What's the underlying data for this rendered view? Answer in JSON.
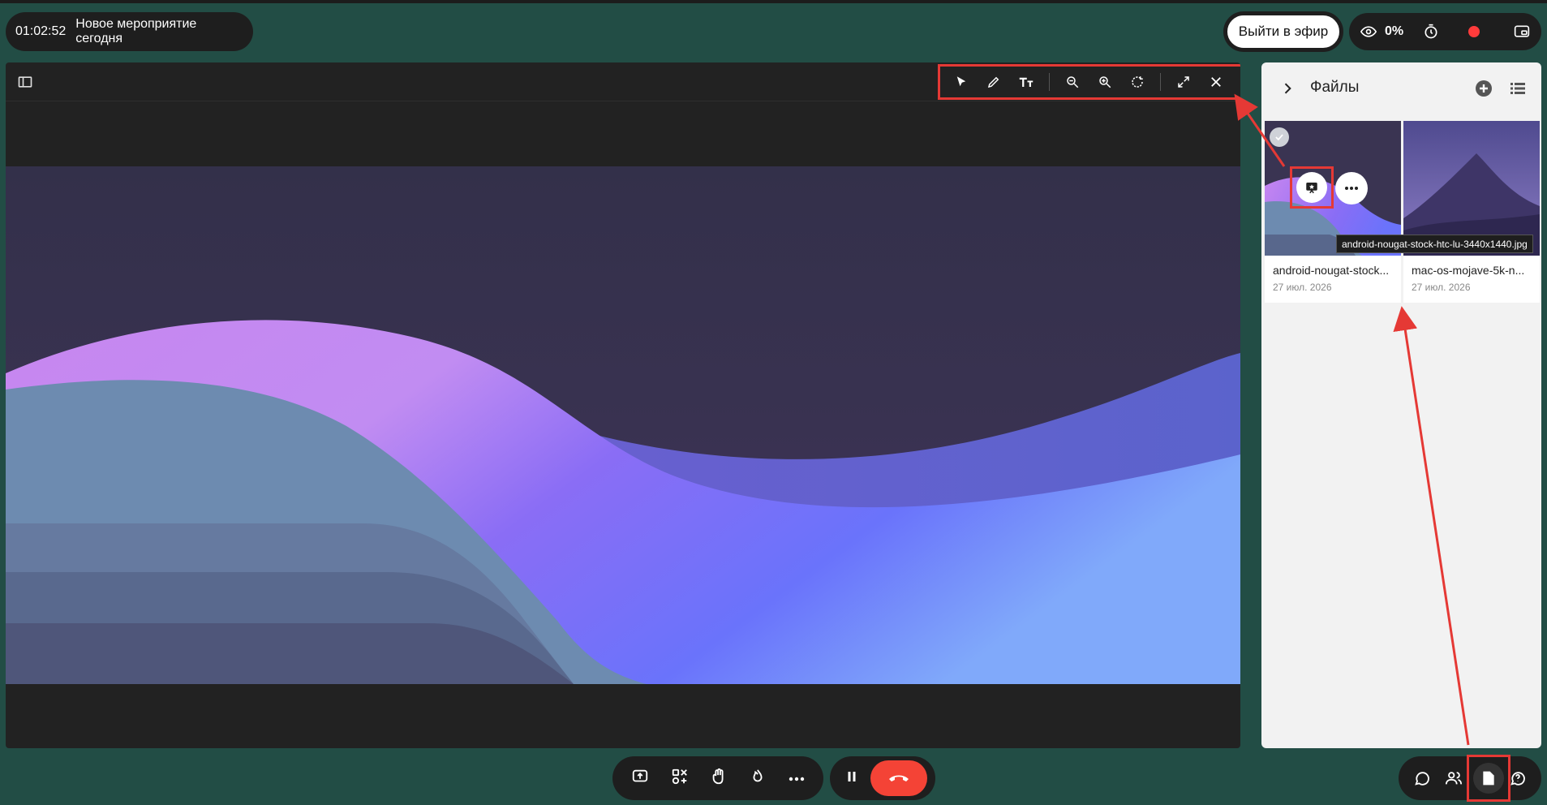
{
  "header": {
    "timer": "01:02:52",
    "event_title": "Новое мероприятие сегодня",
    "go_live_label": "Выйти в эфир",
    "viewers_percent": "0%"
  },
  "viewer": {
    "toolbar_tools": [
      "pointer-icon",
      "pencil-icon",
      "text-size-icon",
      "zoom-out-icon",
      "zoom-in-icon",
      "rotate-icon",
      "fullscreen-icon",
      "close-icon"
    ]
  },
  "files": {
    "title": "Файлы",
    "items": [
      {
        "name": "android-nougat-stock...",
        "date": "27 июл. 2026"
      },
      {
        "name": "mac-os-mojave-5k-n...",
        "date": "27 июл. 2026"
      }
    ],
    "tooltip": "android-nougat-stock-htc-lu-3440x1440.jpg"
  },
  "colors": {
    "background": "#224d45",
    "panel_dark": "#1e1e1e",
    "accent_red": "#e53935",
    "hangup": "#f44336",
    "record": "#ff3b3b"
  }
}
